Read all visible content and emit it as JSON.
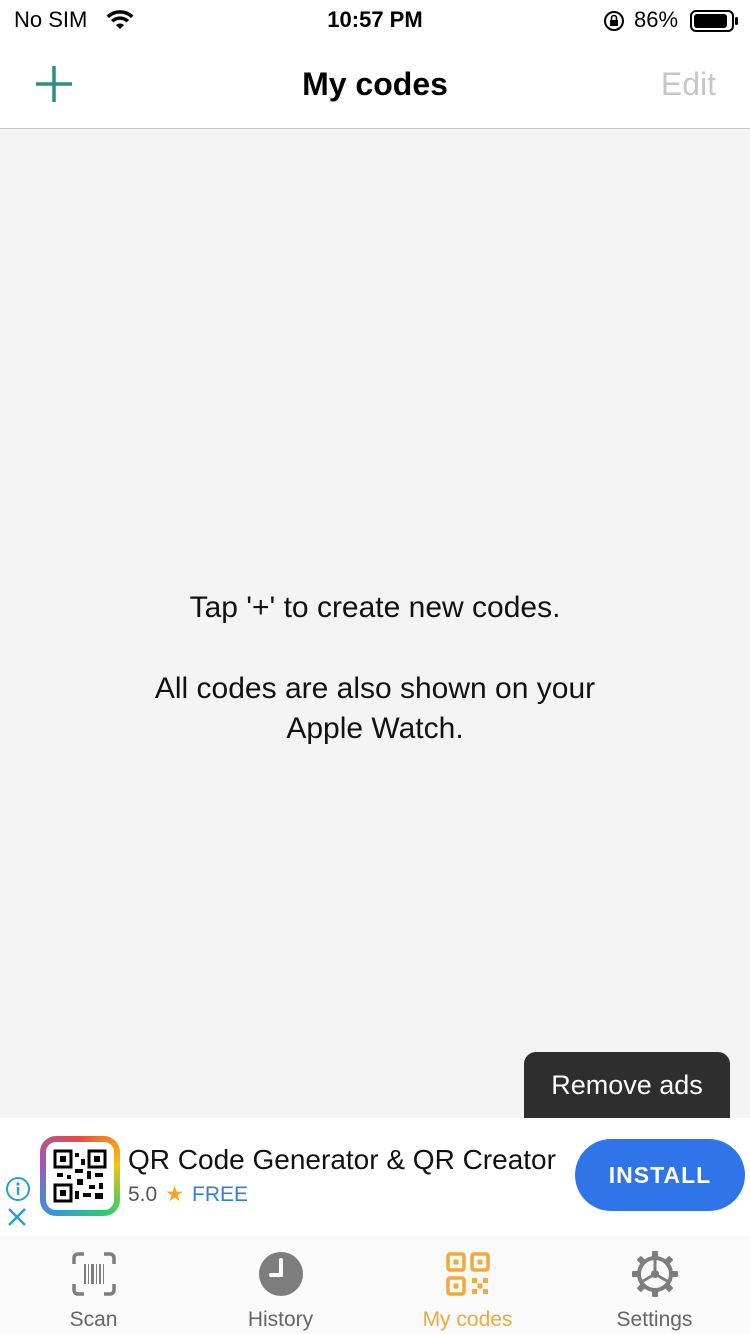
{
  "status_bar": {
    "carrier": "No SIM",
    "time": "10:57 PM",
    "battery_percent": "86%"
  },
  "nav": {
    "title": "My codes",
    "edit_label": "Edit",
    "add_icon": "plus-icon"
  },
  "content": {
    "message_primary": "Tap '+' to create new codes.",
    "message_secondary": "All codes are also shown on your Apple Watch."
  },
  "remove_ads_label": "Remove ads",
  "ad": {
    "app_name": "QR Code Generator & QR Creator",
    "rating": "5.0",
    "star": "★",
    "price": "FREE",
    "install_label": "INSTALL"
  },
  "tabs": [
    {
      "label": "Scan",
      "icon": "barcode-scan-icon",
      "active": false
    },
    {
      "label": "History",
      "icon": "clock-icon",
      "active": false
    },
    {
      "label": "My codes",
      "icon": "qr-code-icon",
      "active": true
    },
    {
      "label": "Settings",
      "icon": "gear-icon",
      "active": false
    }
  ],
  "colors": {
    "accent_green": "#2f8f7f",
    "active_tab": "#f0a93b",
    "install_blue": "#2f74e8"
  }
}
